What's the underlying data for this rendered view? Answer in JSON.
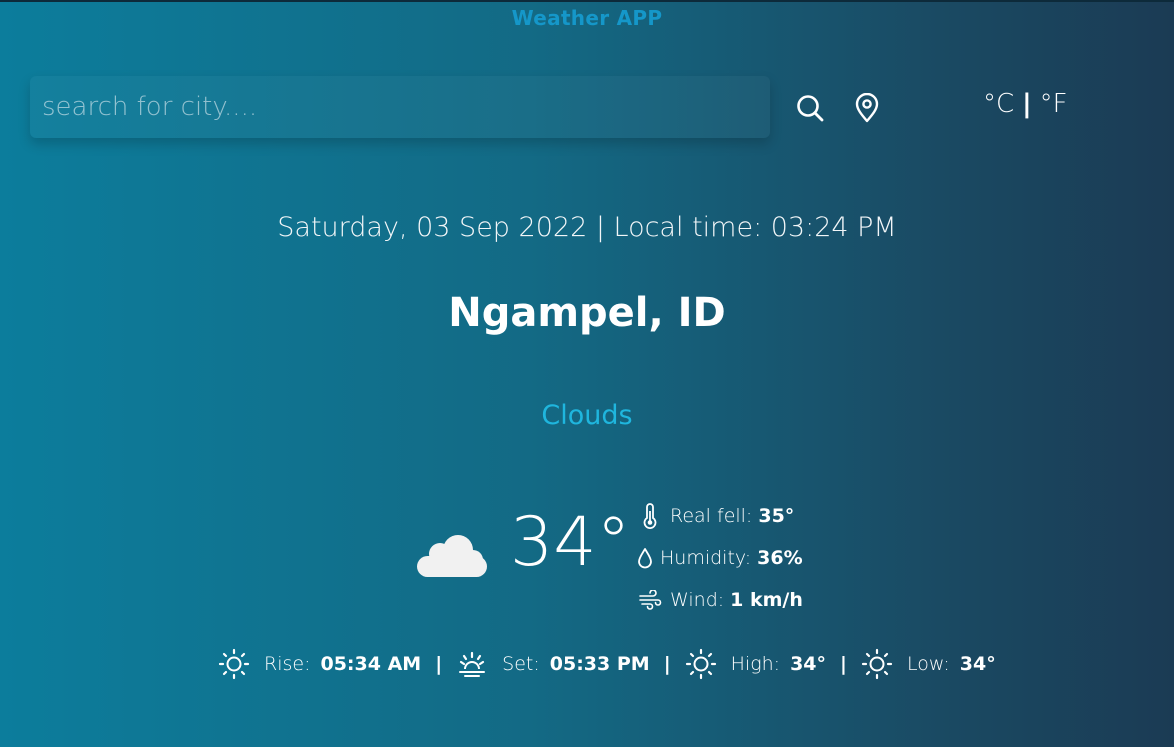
{
  "header": {
    "title": "Weather APP"
  },
  "search": {
    "placeholder": "search for city...."
  },
  "icons": {
    "search": "search-icon",
    "location": "location-pin-icon",
    "cloud": "cloud-icon",
    "thermometer": "thermometer-icon",
    "humidity": "droplet-icon",
    "wind": "wind-icon",
    "sunrise": "sunrise-icon",
    "sunset": "sunset-icon",
    "high": "sun-icon",
    "low": "sun-icon"
  },
  "units": {
    "celsius": "°C",
    "separator": "|",
    "fahrenheit": "°F"
  },
  "weather": {
    "datetime": "Saturday, 03 Sep 2022 | Local time: 03:24 PM",
    "city": "Ngampel, ID",
    "condition": "Clouds",
    "temperature": "34°",
    "details": {
      "real_feel_label": "Real fell:",
      "real_feel_value": "35°",
      "humidity_label": "Humidity:",
      "humidity_value": "36%",
      "wind_label": "Wind:",
      "wind_value": "1 km/h"
    },
    "sun": {
      "rise_label": "Rise:",
      "rise_value": "05:34 AM",
      "set_label": "Set:",
      "set_value": "05:33 PM",
      "high_label": "High:",
      "high_value": "34°",
      "low_label": "Low:",
      "low_value": "34°",
      "divider": "|"
    }
  },
  "colors": {
    "title": "#1597c9",
    "condition": "#1fb6de",
    "bg_left": "#0c7d9c",
    "bg_right": "#1b3b54"
  }
}
